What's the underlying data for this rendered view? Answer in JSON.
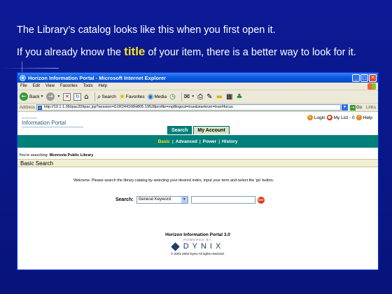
{
  "slide": {
    "line1": "The Library’s catalog looks like this when you first open it.",
    "line2_pre": "If you already know the ",
    "line2_highlight": "title",
    "line2_post": " of your item, there is a better way to look for it."
  },
  "browser": {
    "title": "Horizon Information Portal - Microsoft Internet Explorer",
    "menu": [
      "File",
      "Edit",
      "View",
      "Favorites",
      "Tools",
      "Help"
    ],
    "toolbar": {
      "back": "Back",
      "search": "Search",
      "favorites": "Favorites",
      "media": "Media"
    },
    "address_label": "Address",
    "address_value": "http://10.1.1.36/ipac20/ipac.jsp?session=G1R244168H805.19528profile=mp8logout=true&startover=true#focus",
    "go_label": "Go",
    "links_label": "Links"
  },
  "portal": {
    "brand_small": "HORIZON",
    "brand_big": "Information Portal",
    "login": "Login",
    "mylist": "My List - 0",
    "help": "Help",
    "tabs": [
      "Search",
      "My Account"
    ],
    "subnav": [
      "Basic",
      "Advanced",
      "Power",
      "History"
    ],
    "searching_label": "You're searching:",
    "searching_value": "Monrovia Public Library",
    "section_title": "Basic Search",
    "welcome": "Welcome. Please search the library catalog by selecting your desired index, input your term and select the 'go' button.",
    "search_label": "Search:",
    "search_index": "General Keyword",
    "go_button": "GO",
    "footer_version": "Horizon Information Portal 3.0",
    "footer_powered": "POWERED BY",
    "footer_brand": "DYNIX",
    "footer_copyright": "© 2001-2004 Dynix All rights reserved."
  },
  "colors": {
    "slide_bg": "#0a1a8c",
    "highlight": "#ffe21a",
    "portal_green": "#00807a"
  }
}
